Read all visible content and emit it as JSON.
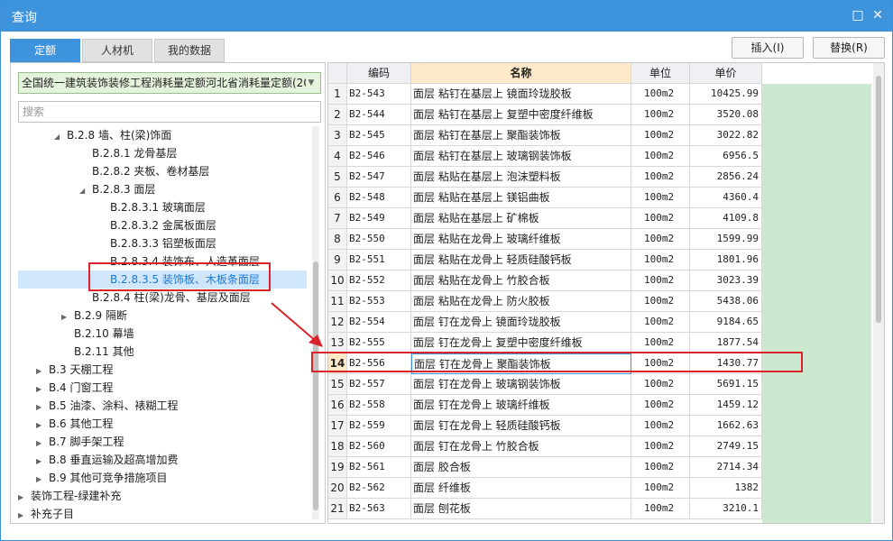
{
  "window": {
    "title": "查询",
    "minimize_icon": "□",
    "close_icon": "✕"
  },
  "tabs": [
    {
      "label": "定额",
      "active": true
    },
    {
      "label": "人材机",
      "active": false
    },
    {
      "label": "我的数据",
      "active": false
    }
  ],
  "toolbar": {
    "insert_label": "插入(I)",
    "replace_label": "替换(R)"
  },
  "left": {
    "quota_library": "全国统一建筑装饰装修工程消耗量定额河北省消耗量定额(20",
    "search_placeholder": "搜索",
    "tree": [
      {
        "label": "B.2.8 墙、柱(梁)饰面",
        "toggle": "◢",
        "selected": false
      },
      {
        "label": "B.2.8.1 龙骨基层",
        "toggle": "",
        "selected": false
      },
      {
        "label": "B.2.8.2 夹板、卷材基层",
        "toggle": "",
        "selected": false
      },
      {
        "label": "B.2.8.3 面层",
        "toggle": "◢",
        "selected": false
      },
      {
        "label": "B.2.8.3.1 玻璃面层",
        "toggle": "",
        "selected": false
      },
      {
        "label": "B.2.8.3.2 金属板面层",
        "toggle": "",
        "selected": false
      },
      {
        "label": "B.2.8.3.3 铝塑板面层",
        "toggle": "",
        "selected": false
      },
      {
        "label": "B.2.8.3.4 装饰布、人造革面层",
        "toggle": "",
        "selected": false
      },
      {
        "label": "B.2.8.3.5 装饰板、木板条面层",
        "toggle": "",
        "selected": true
      },
      {
        "label": "B.2.8.4 柱(梁)龙骨、基层及面层",
        "toggle": "",
        "selected": false
      },
      {
        "label": "B.2.9 隔断",
        "toggle": "▶",
        "selected": false
      },
      {
        "label": "B.2.10 幕墙",
        "toggle": "",
        "selected": false
      },
      {
        "label": "B.2.11 其他",
        "toggle": "",
        "selected": false
      },
      {
        "label": "B.3 天棚工程",
        "toggle": "▶",
        "selected": false
      },
      {
        "label": "B.4 门窗工程",
        "toggle": "▶",
        "selected": false
      },
      {
        "label": "B.5 油漆、涂料、裱糊工程",
        "toggle": "▶",
        "selected": false
      },
      {
        "label": "B.6 其他工程",
        "toggle": "▶",
        "selected": false
      },
      {
        "label": "B.7 脚手架工程",
        "toggle": "▶",
        "selected": false
      },
      {
        "label": "B.8 垂直运输及超高增加费",
        "toggle": "▶",
        "selected": false
      },
      {
        "label": "B.9 其他可竞争措施项目",
        "toggle": "▶",
        "selected": false
      },
      {
        "label": "装饰工程-绿建补充",
        "toggle": "▶",
        "selected": false
      },
      {
        "label": "补充子目",
        "toggle": "▶",
        "selected": false
      }
    ]
  },
  "table": {
    "headers": [
      "",
      "编码",
      "名称",
      "单位",
      "单价"
    ],
    "selected_row": "14",
    "rows": [
      {
        "no": "1",
        "code": "B2-543",
        "name": "面层 粘钉在基层上 镜面玲珑胶板",
        "unit": "100m2",
        "price": "10425.99"
      },
      {
        "no": "2",
        "code": "B2-544",
        "name": "面层 粘钉在基层上 复塑中密度纤维板",
        "unit": "100m2",
        "price": "3520.08"
      },
      {
        "no": "3",
        "code": "B2-545",
        "name": "面层 粘钉在基层上 聚酯装饰板",
        "unit": "100m2",
        "price": "3022.82"
      },
      {
        "no": "4",
        "code": "B2-546",
        "name": "面层 粘钉在基层上 玻璃钢装饰板",
        "unit": "100m2",
        "price": "6956.5"
      },
      {
        "no": "5",
        "code": "B2-547",
        "name": "面层 粘贴在基层上 泡沫塑料板",
        "unit": "100m2",
        "price": "2856.24"
      },
      {
        "no": "6",
        "code": "B2-548",
        "name": "面层 粘贴在基层上 镁铝曲板",
        "unit": "100m2",
        "price": "4360.4"
      },
      {
        "no": "7",
        "code": "B2-549",
        "name": "面层 粘贴在基层上 矿棉板",
        "unit": "100m2",
        "price": "4109.8"
      },
      {
        "no": "8",
        "code": "B2-550",
        "name": "面层 粘贴在龙骨上 玻璃纤维板",
        "unit": "100m2",
        "price": "1599.99"
      },
      {
        "no": "9",
        "code": "B2-551",
        "name": "面层 粘贴在龙骨上 轻质硅酸钙板",
        "unit": "100m2",
        "price": "1801.96"
      },
      {
        "no": "10",
        "code": "B2-552",
        "name": "面层 粘贴在龙骨上 竹胶合板",
        "unit": "100m2",
        "price": "3023.39"
      },
      {
        "no": "11",
        "code": "B2-553",
        "name": "面层 粘贴在龙骨上 防火胶板",
        "unit": "100m2",
        "price": "5438.06"
      },
      {
        "no": "12",
        "code": "B2-554",
        "name": "面层 钉在龙骨上 镜面玲珑胶板",
        "unit": "100m2",
        "price": "9184.65"
      },
      {
        "no": "13",
        "code": "B2-555",
        "name": "面层 钉在龙骨上 复塑中密度纤维板",
        "unit": "100m2",
        "price": "1877.54"
      },
      {
        "no": "14",
        "code": "B2-556",
        "name": "面层 钉在龙骨上 聚酯装饰板",
        "unit": "100m2",
        "price": "1430.77"
      },
      {
        "no": "15",
        "code": "B2-557",
        "name": "面层 钉在龙骨上 玻璃钢装饰板",
        "unit": "100m2",
        "price": "5691.15"
      },
      {
        "no": "16",
        "code": "B2-558",
        "name": "面层 钉在龙骨上 玻璃纤维板",
        "unit": "100m2",
        "price": "1459.12"
      },
      {
        "no": "17",
        "code": "B2-559",
        "name": "面层 钉在龙骨上 轻质硅酸钙板",
        "unit": "100m2",
        "price": "1662.63"
      },
      {
        "no": "18",
        "code": "B2-560",
        "name": "面层 钉在龙骨上 竹胶合板",
        "unit": "100m2",
        "price": "2749.15"
      },
      {
        "no": "19",
        "code": "B2-561",
        "name": "面层 胶合板",
        "unit": "100m2",
        "price": "2714.34"
      },
      {
        "no": "20",
        "code": "B2-562",
        "name": "面层 纤维板",
        "unit": "100m2",
        "price": "1382"
      },
      {
        "no": "21",
        "code": "B2-563",
        "name": "面层 刨花板",
        "unit": "100m2",
        "price": "3210.1"
      }
    ]
  },
  "colors": {
    "accent": "#3d94dc",
    "highlight": "#d9232a",
    "green": "#cce8cf"
  }
}
